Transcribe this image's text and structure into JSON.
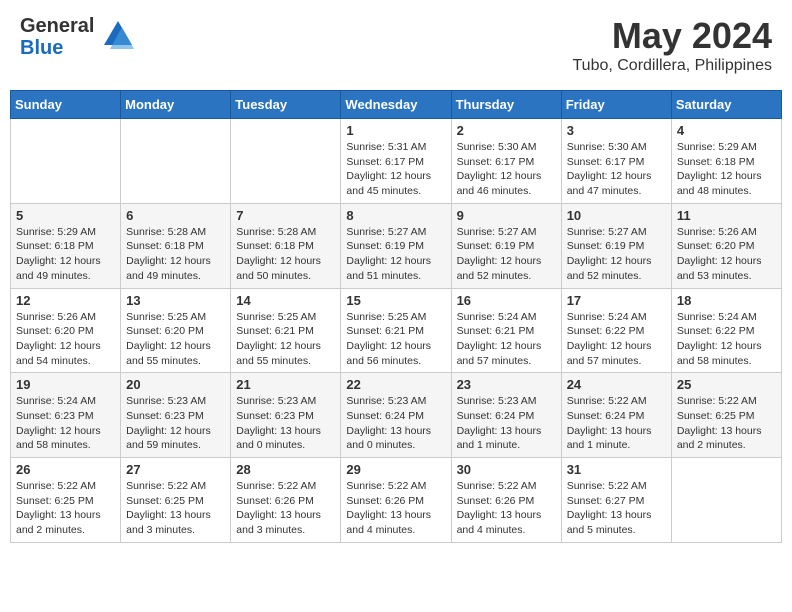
{
  "logo": {
    "text_general": "General",
    "text_blue": "Blue"
  },
  "title": "May 2024",
  "subtitle": "Tubo, Cordillera, Philippines",
  "days_of_week": [
    "Sunday",
    "Monday",
    "Tuesday",
    "Wednesday",
    "Thursday",
    "Friday",
    "Saturday"
  ],
  "weeks": [
    [
      {
        "day": "",
        "info": ""
      },
      {
        "day": "",
        "info": ""
      },
      {
        "day": "",
        "info": ""
      },
      {
        "day": "1",
        "info": "Sunrise: 5:31 AM\nSunset: 6:17 PM\nDaylight: 12 hours\nand 45 minutes."
      },
      {
        "day": "2",
        "info": "Sunrise: 5:30 AM\nSunset: 6:17 PM\nDaylight: 12 hours\nand 46 minutes."
      },
      {
        "day": "3",
        "info": "Sunrise: 5:30 AM\nSunset: 6:17 PM\nDaylight: 12 hours\nand 47 minutes."
      },
      {
        "day": "4",
        "info": "Sunrise: 5:29 AM\nSunset: 6:18 PM\nDaylight: 12 hours\nand 48 minutes."
      }
    ],
    [
      {
        "day": "5",
        "info": "Sunrise: 5:29 AM\nSunset: 6:18 PM\nDaylight: 12 hours\nand 49 minutes."
      },
      {
        "day": "6",
        "info": "Sunrise: 5:28 AM\nSunset: 6:18 PM\nDaylight: 12 hours\nand 49 minutes."
      },
      {
        "day": "7",
        "info": "Sunrise: 5:28 AM\nSunset: 6:18 PM\nDaylight: 12 hours\nand 50 minutes."
      },
      {
        "day": "8",
        "info": "Sunrise: 5:27 AM\nSunset: 6:19 PM\nDaylight: 12 hours\nand 51 minutes."
      },
      {
        "day": "9",
        "info": "Sunrise: 5:27 AM\nSunset: 6:19 PM\nDaylight: 12 hours\nand 52 minutes."
      },
      {
        "day": "10",
        "info": "Sunrise: 5:27 AM\nSunset: 6:19 PM\nDaylight: 12 hours\nand 52 minutes."
      },
      {
        "day": "11",
        "info": "Sunrise: 5:26 AM\nSunset: 6:20 PM\nDaylight: 12 hours\nand 53 minutes."
      }
    ],
    [
      {
        "day": "12",
        "info": "Sunrise: 5:26 AM\nSunset: 6:20 PM\nDaylight: 12 hours\nand 54 minutes."
      },
      {
        "day": "13",
        "info": "Sunrise: 5:25 AM\nSunset: 6:20 PM\nDaylight: 12 hours\nand 55 minutes."
      },
      {
        "day": "14",
        "info": "Sunrise: 5:25 AM\nSunset: 6:21 PM\nDaylight: 12 hours\nand 55 minutes."
      },
      {
        "day": "15",
        "info": "Sunrise: 5:25 AM\nSunset: 6:21 PM\nDaylight: 12 hours\nand 56 minutes."
      },
      {
        "day": "16",
        "info": "Sunrise: 5:24 AM\nSunset: 6:21 PM\nDaylight: 12 hours\nand 57 minutes."
      },
      {
        "day": "17",
        "info": "Sunrise: 5:24 AM\nSunset: 6:22 PM\nDaylight: 12 hours\nand 57 minutes."
      },
      {
        "day": "18",
        "info": "Sunrise: 5:24 AM\nSunset: 6:22 PM\nDaylight: 12 hours\nand 58 minutes."
      }
    ],
    [
      {
        "day": "19",
        "info": "Sunrise: 5:24 AM\nSunset: 6:23 PM\nDaylight: 12 hours\nand 58 minutes."
      },
      {
        "day": "20",
        "info": "Sunrise: 5:23 AM\nSunset: 6:23 PM\nDaylight: 12 hours\nand 59 minutes."
      },
      {
        "day": "21",
        "info": "Sunrise: 5:23 AM\nSunset: 6:23 PM\nDaylight: 13 hours\nand 0 minutes."
      },
      {
        "day": "22",
        "info": "Sunrise: 5:23 AM\nSunset: 6:24 PM\nDaylight: 13 hours\nand 0 minutes."
      },
      {
        "day": "23",
        "info": "Sunrise: 5:23 AM\nSunset: 6:24 PM\nDaylight: 13 hours\nand 1 minute."
      },
      {
        "day": "24",
        "info": "Sunrise: 5:22 AM\nSunset: 6:24 PM\nDaylight: 13 hours\nand 1 minute."
      },
      {
        "day": "25",
        "info": "Sunrise: 5:22 AM\nSunset: 6:25 PM\nDaylight: 13 hours\nand 2 minutes."
      }
    ],
    [
      {
        "day": "26",
        "info": "Sunrise: 5:22 AM\nSunset: 6:25 PM\nDaylight: 13 hours\nand 2 minutes."
      },
      {
        "day": "27",
        "info": "Sunrise: 5:22 AM\nSunset: 6:25 PM\nDaylight: 13 hours\nand 3 minutes."
      },
      {
        "day": "28",
        "info": "Sunrise: 5:22 AM\nSunset: 6:26 PM\nDaylight: 13 hours\nand 3 minutes."
      },
      {
        "day": "29",
        "info": "Sunrise: 5:22 AM\nSunset: 6:26 PM\nDaylight: 13 hours\nand 4 minutes."
      },
      {
        "day": "30",
        "info": "Sunrise: 5:22 AM\nSunset: 6:26 PM\nDaylight: 13 hours\nand 4 minutes."
      },
      {
        "day": "31",
        "info": "Sunrise: 5:22 AM\nSunset: 6:27 PM\nDaylight: 13 hours\nand 5 minutes."
      },
      {
        "day": "",
        "info": ""
      }
    ]
  ]
}
